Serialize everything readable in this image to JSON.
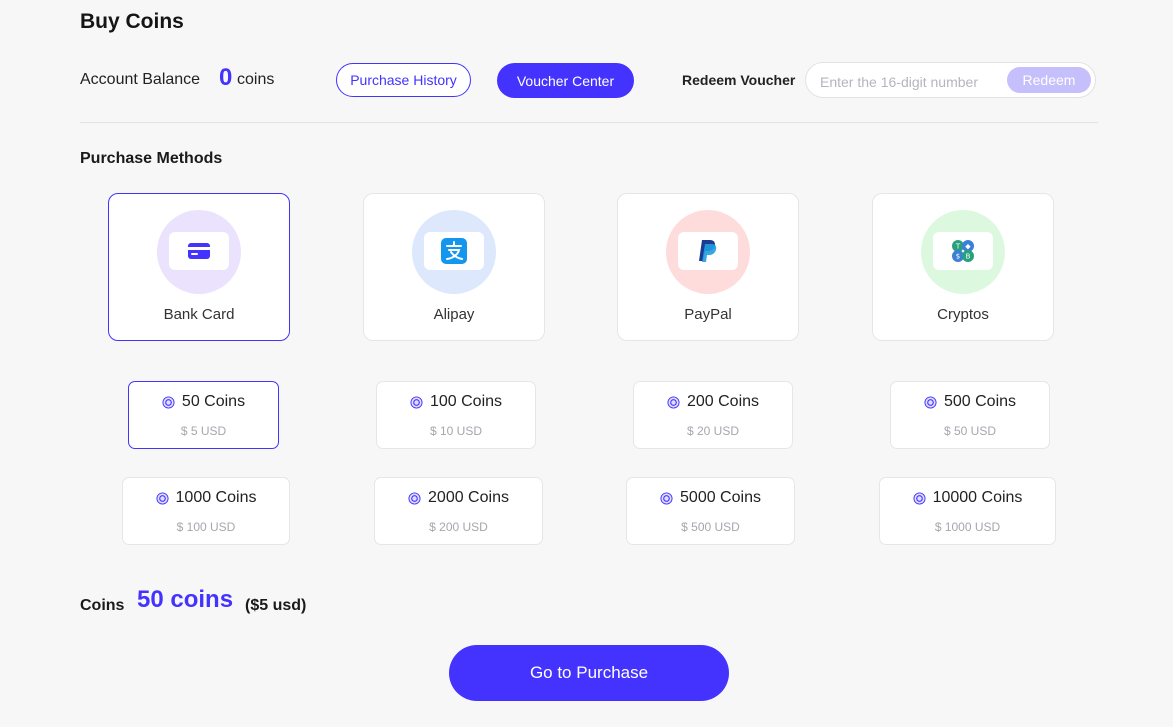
{
  "page": {
    "title": "Buy Coins"
  },
  "balance": {
    "label": "Account Balance",
    "value": "0",
    "unit": "coins"
  },
  "actions": {
    "purchase_history": "Purchase History",
    "voucher_center": "Voucher Center"
  },
  "redeem": {
    "label": "Redeem Voucher",
    "placeholder": "Enter the 16-digit number",
    "button": "Redeem"
  },
  "methods": {
    "title": "Purchase Methods",
    "items": [
      {
        "label": "Bank Card",
        "icon": "credit-card-icon",
        "circle_color": "#ebe2fd",
        "selected": true
      },
      {
        "label": "Alipay",
        "icon": "alipay-icon",
        "circle_color": "#dde8fd",
        "selected": false
      },
      {
        "label": "PayPal",
        "icon": "paypal-icon",
        "circle_color": "#fddcdb",
        "selected": false
      },
      {
        "label": "Cryptos",
        "icon": "crypto-coins-icon",
        "circle_color": "#dcf9e0",
        "selected": false
      }
    ]
  },
  "packages": [
    {
      "coins": "50 Coins",
      "price": "$ 5 USD",
      "selected": true
    },
    {
      "coins": "100 Coins",
      "price": "$ 10 USD",
      "selected": false
    },
    {
      "coins": "200 Coins",
      "price": "$ 20 USD",
      "selected": false
    },
    {
      "coins": "500 Coins",
      "price": "$ 50 USD",
      "selected": false
    },
    {
      "coins": "1000 Coins",
      "price": "$ 100 USD",
      "selected": false
    },
    {
      "coins": "2000 Coins",
      "price": "$ 200 USD",
      "selected": false
    },
    {
      "coins": "5000 Coins",
      "price": "$ 500 USD",
      "selected": false
    },
    {
      "coins": "10000 Coins",
      "price": "$ 1000 USD",
      "selected": false
    }
  ],
  "summary": {
    "label": "Coins",
    "value": "50 coins",
    "usd": "($5 usd)"
  },
  "purchase_button": "Go to Purchase",
  "colors": {
    "accent": "#4433ff",
    "redeem_disabled": "#c5c0fb"
  }
}
